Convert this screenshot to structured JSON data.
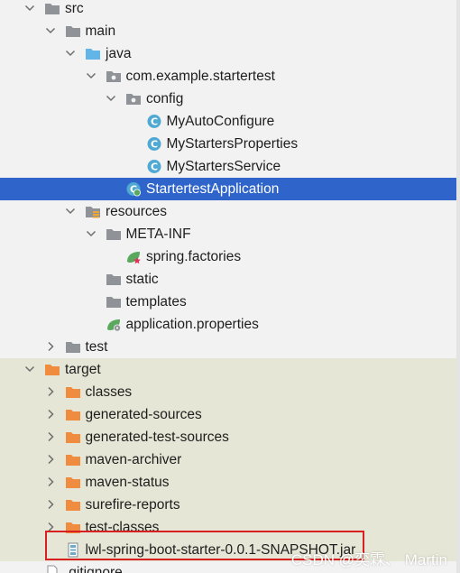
{
  "tree": {
    "nodes": [
      {
        "label": "src",
        "kind": "folder-gray",
        "depth": 0,
        "chevron": "down"
      },
      {
        "label": "main",
        "kind": "folder-gray",
        "depth": 1,
        "chevron": "down"
      },
      {
        "label": "java",
        "kind": "folder-blue",
        "depth": 2,
        "chevron": "down"
      },
      {
        "label": "com.example.startertest",
        "kind": "package",
        "depth": 3,
        "chevron": "down"
      },
      {
        "label": "config",
        "kind": "package",
        "depth": 4,
        "chevron": "down"
      },
      {
        "label": "MyAutoConfigure",
        "kind": "class",
        "depth": 5,
        "chevron": "none"
      },
      {
        "label": "MyStartersProperties",
        "kind": "class",
        "depth": 5,
        "chevron": "none"
      },
      {
        "label": "MyStartersService",
        "kind": "class",
        "depth": 5,
        "chevron": "none"
      },
      {
        "label": "StartertestApplication",
        "kind": "spring-class",
        "depth": 4,
        "chevron": "none",
        "selected": true
      },
      {
        "label": "resources",
        "kind": "folder-resources",
        "depth": 2,
        "chevron": "down"
      },
      {
        "label": "META-INF",
        "kind": "folder-gray",
        "depth": 3,
        "chevron": "down"
      },
      {
        "label": "spring.factories",
        "kind": "spring-factories",
        "depth": 4,
        "chevron": "none"
      },
      {
        "label": "static",
        "kind": "folder-gray",
        "depth": 3,
        "chevron": "none"
      },
      {
        "label": "templates",
        "kind": "folder-gray",
        "depth": 3,
        "chevron": "none"
      },
      {
        "label": "application.properties",
        "kind": "spring-properties",
        "depth": 3,
        "chevron": "none"
      },
      {
        "label": "test",
        "kind": "folder-gray",
        "depth": 1,
        "chevron": "right"
      },
      {
        "label": "target",
        "kind": "folder-orange",
        "depth": 0,
        "chevron": "down",
        "excluded": true
      },
      {
        "label": "classes",
        "kind": "folder-orange",
        "depth": 1,
        "chevron": "right",
        "excluded": true
      },
      {
        "label": "generated-sources",
        "kind": "folder-orange",
        "depth": 1,
        "chevron": "right",
        "excluded": true
      },
      {
        "label": "generated-test-sources",
        "kind": "folder-orange",
        "depth": 1,
        "chevron": "right",
        "excluded": true
      },
      {
        "label": "maven-archiver",
        "kind": "folder-orange",
        "depth": 1,
        "chevron": "right",
        "excluded": true
      },
      {
        "label": "maven-status",
        "kind": "folder-orange",
        "depth": 1,
        "chevron": "right",
        "excluded": true
      },
      {
        "label": "surefire-reports",
        "kind": "folder-orange",
        "depth": 1,
        "chevron": "right",
        "excluded": true
      },
      {
        "label": "test-classes",
        "kind": "folder-orange",
        "depth": 1,
        "chevron": "right",
        "excluded": true
      },
      {
        "label": "lwl-spring-boot-starter-0.0.1-SNAPSHOT.jar",
        "kind": "jar",
        "depth": 1,
        "chevron": "none",
        "excluded": true
      },
      {
        "label": ".gitignore",
        "kind": "file",
        "depth": 0,
        "chevron": "none"
      }
    ]
  },
  "colors": {
    "selection": "#2f65ca",
    "excluded_bg": "#e6e6d6",
    "folder_gray": "#8f9296",
    "folder_blue": "#62b6e7",
    "folder_orange": "#f08c3f",
    "class_icon": "#4fa9d3",
    "spring_green": "#59a85e",
    "highlight_red": "#d92020"
  },
  "watermark": "CSDN @奕霖、 Martin"
}
